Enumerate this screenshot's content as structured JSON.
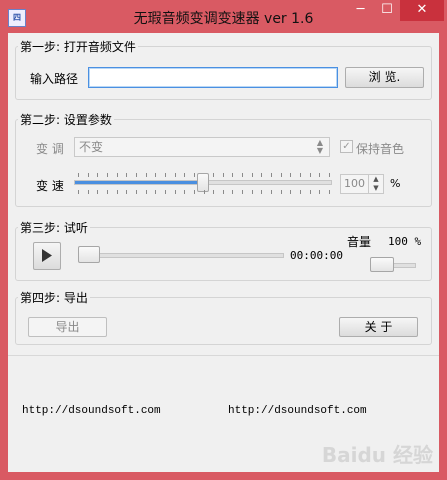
{
  "window": {
    "title": "无瑕音频变调变速器 ver 1.6",
    "icon_text": "四",
    "minimize_glyph": "─",
    "maximize_glyph": "☐",
    "close_glyph": "✕"
  },
  "step1": {
    "legend": "第一步: 打开音频文件",
    "path_label": "输入路径",
    "path_value": "",
    "browse_button": "浏 览."
  },
  "step2": {
    "legend": "第二步: 设置参数",
    "pitch_label": "变 调",
    "pitch_value": "不变",
    "keep_tone_label": "保持音色",
    "keep_tone_checked": true,
    "speed_label": "变 速",
    "speed_slider_level": 0.5,
    "speed_value": "100",
    "speed_unit": "%"
  },
  "step3": {
    "legend": "第三步: 试听",
    "position_level": 0.0,
    "time": "00:00:00",
    "volume_label": "音量",
    "volume_value": "100 %",
    "volume_level": 0.25
  },
  "step4": {
    "legend": "第四步: 导出",
    "export_button": "导出",
    "about_button": "关 于"
  },
  "footer": {
    "link_left": "http://dsoundsoft.com",
    "link_right": "http://dsoundsoft.com"
  },
  "watermark": "Baidu 经验"
}
